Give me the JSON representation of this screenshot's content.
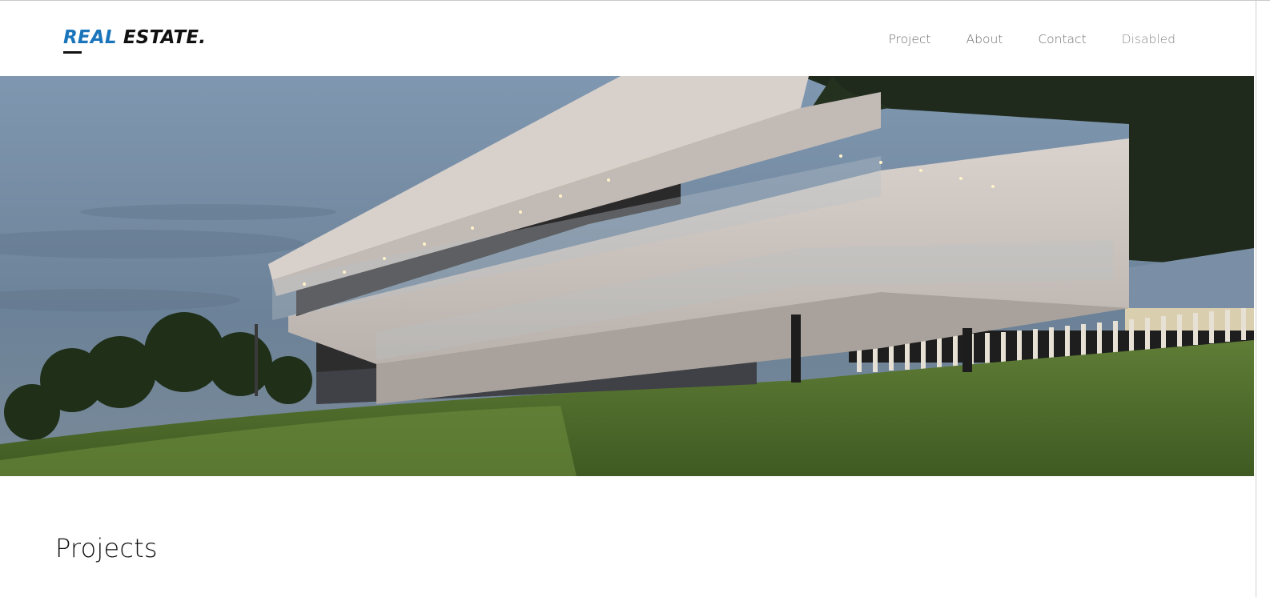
{
  "brand": {
    "accent": "REAL",
    "rest": " ESTATE.",
    "accent_color": "#1b75bb"
  },
  "nav": {
    "items": [
      {
        "label": "Project"
      },
      {
        "label": "About"
      },
      {
        "label": "Contact"
      },
      {
        "label": "Disabled"
      }
    ]
  },
  "hero": {
    "image": "modern-cantilevered-house-at-dusk"
  },
  "projects": {
    "title": "Projects"
  }
}
